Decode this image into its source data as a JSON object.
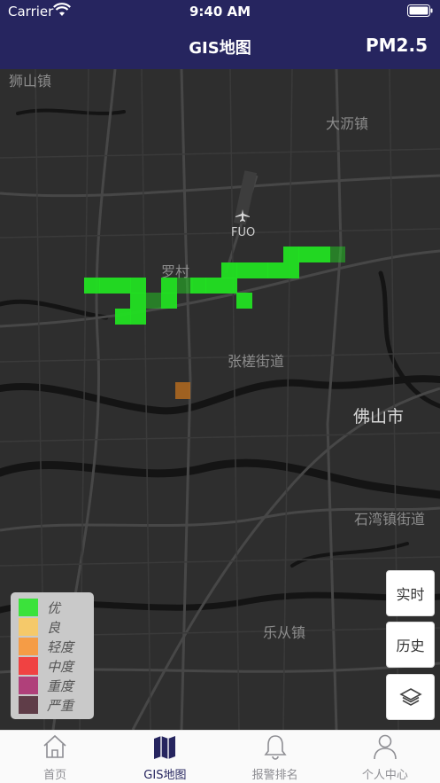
{
  "status_bar": {
    "carrier": "Carrier",
    "time": "9:40 AM"
  },
  "nav": {
    "title": "GIS地图",
    "right_label": "PM2.5"
  },
  "map": {
    "places": [
      {
        "id": "shishan",
        "text": "狮山镇"
      },
      {
        "id": "dali",
        "text": "大沥镇"
      },
      {
        "id": "luocun",
        "text": "罗村"
      },
      {
        "id": "zhangcha",
        "text": "张槎街道"
      },
      {
        "id": "foshan",
        "text": "佛山市"
      },
      {
        "id": "shiwan",
        "text": "石湾镇街道"
      },
      {
        "id": "lecong",
        "text": "乐从镇"
      }
    ],
    "airport_code": "FUO",
    "pm25_cells_level": "优",
    "single_cell_level": "轻度"
  },
  "legend": {
    "items": [
      {
        "label": "优",
        "color": "#3be23b"
      },
      {
        "label": "良",
        "color": "#f5c96a"
      },
      {
        "label": "轻度",
        "color": "#f59c46"
      },
      {
        "label": "中度",
        "color": "#f04242"
      },
      {
        "label": "重度",
        "color": "#b0407a"
      },
      {
        "label": "严重",
        "color": "#5f3d48"
      }
    ]
  },
  "buttons": {
    "realtime": "实时",
    "history": "历史",
    "layers_icon": "layers-icon"
  },
  "tabbar": {
    "tabs": [
      {
        "label": "首页",
        "icon": "home-icon",
        "active": false
      },
      {
        "label": "GIS地图",
        "icon": "map-icon",
        "active": true
      },
      {
        "label": "报警排名",
        "icon": "bell-icon",
        "active": false
      },
      {
        "label": "个人中心",
        "icon": "user-icon",
        "active": false
      }
    ]
  },
  "colors": {
    "nav_bg": "#26255f",
    "good": "#22e022",
    "light": "#b36a1f"
  }
}
